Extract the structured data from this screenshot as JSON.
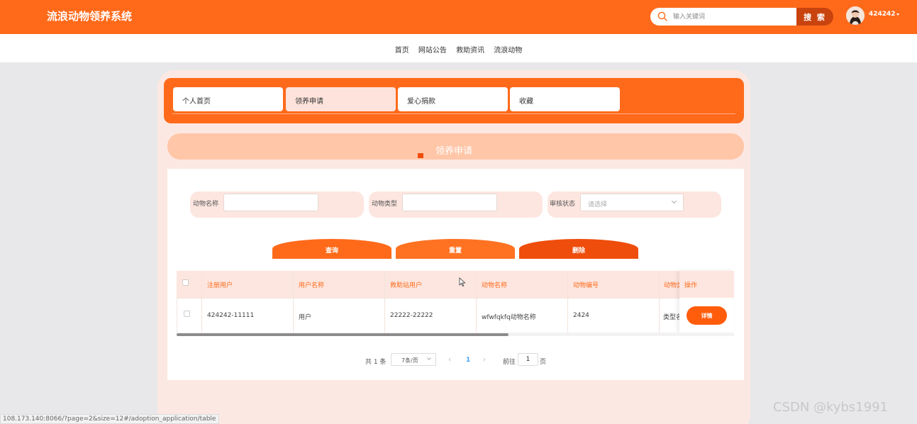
{
  "header": {
    "brand": "流浪动物领养系统",
    "search_placeholder": "输入关键词",
    "search_button": "搜 索",
    "username": "424242"
  },
  "nav": [
    "首页",
    "网站公告",
    "救助资讯",
    "流浪动物"
  ],
  "tabs": [
    {
      "label": "个人首页",
      "active": false
    },
    {
      "label": "领养申请",
      "active": true
    },
    {
      "label": "爱心捐款",
      "active": false
    },
    {
      "label": "收藏",
      "active": false
    }
  ],
  "page_title": "领养申请",
  "filters": {
    "animal_name_label": "动物名称",
    "animal_name_value": "",
    "animal_type_label": "动物类型",
    "animal_type_value": "",
    "review_status_label": "审核状态",
    "review_status_placeholder": "请选择"
  },
  "actions": {
    "query": "查询",
    "reset": "重置",
    "delete": "删除"
  },
  "colors": {
    "primary": "#ff6a1a",
    "query_button": "#ff6a1a",
    "reset_button": "#ff7222",
    "delete_button": "#ef4d0c"
  },
  "table": {
    "headers": [
      "注册用户",
      "用户名称",
      "救助站用户",
      "动物名称",
      "动物编号",
      "动物类"
    ],
    "action_header": "操作",
    "rows": [
      {
        "cells": [
          "424242-11111",
          "用户",
          "22222-22222",
          "wfwfqkfq动物名称",
          "2424",
          "类型名"
        ],
        "detail": "详情"
      }
    ]
  },
  "pagination": {
    "total": "共 1 条",
    "page_size": "7条/页",
    "current_page": "1",
    "goto_prefix": "前往",
    "goto_value": "1",
    "goto_suffix": "页"
  },
  "status_url": "108.173.140:8066/?page=2&size=12#/adoption_application/table",
  "watermark": "CSDN @kybs1991"
}
